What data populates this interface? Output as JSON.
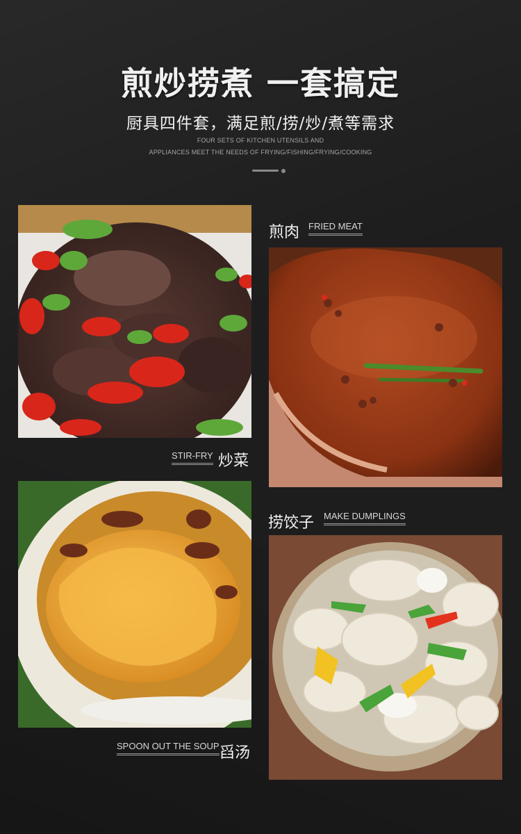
{
  "header": {
    "title": "煎炒捞煮 一套搞定",
    "subtitle": "厨具四件套，满足煎/捞/炒/煮等需求",
    "en_line_1": "FOUR SETS OF KITCHEN UTENSILS AND",
    "en_line_2": "APPLIANCES MEET THE NEEDS OF FRYING/FISHING/FRYING/COOKING"
  },
  "sections": {
    "fried_meat": {
      "cn": "煎肉",
      "en": "FRIED MEAT"
    },
    "stir_fry": {
      "cn": "炒菜",
      "en": "STIR-FRY"
    },
    "dumplings": {
      "cn": "捞饺子",
      "en": "MAKE DUMPLINGS"
    },
    "soup": {
      "cn": "舀汤",
      "en": "SPOON OUT THE SOUP"
    }
  },
  "colors": {
    "background": "#1c1c1d",
    "text": "#f2f2f2",
    "accent_gray": "#8a8a8a"
  }
}
